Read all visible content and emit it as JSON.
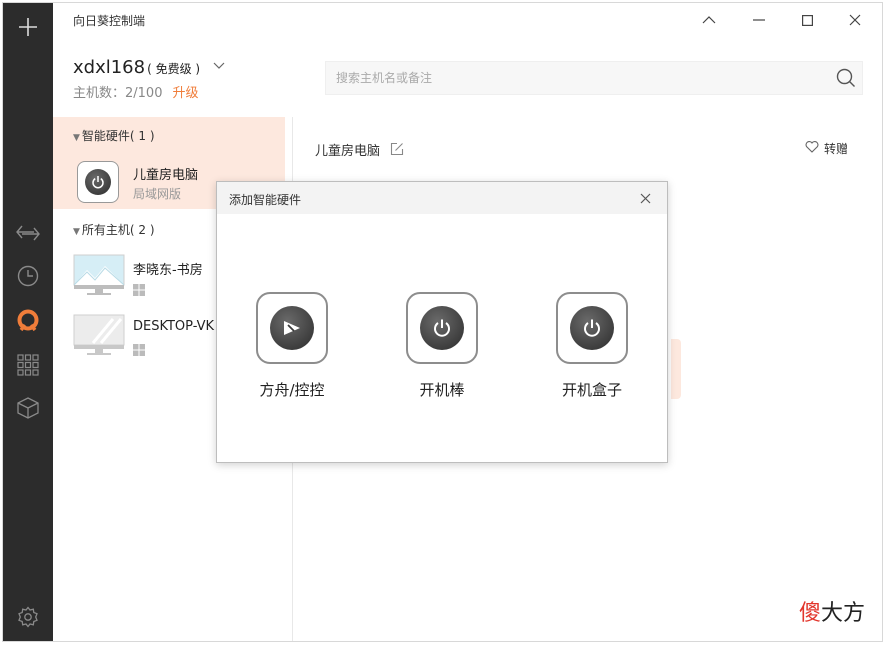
{
  "app": {
    "title": "向日葵控制端"
  },
  "account": {
    "username": "xdxl168",
    "plan": "( 免费级 )",
    "host_count": "主机数：2/100",
    "upgrade": "升级"
  },
  "search": {
    "placeholder": "搜索主机名或备注"
  },
  "groups": {
    "smart": {
      "label": "智能硬件( 1 )",
      "device": {
        "name": "儿童房电脑",
        "sub": "局域网版"
      }
    },
    "hosts": {
      "label": "所有主机( 2 )",
      "items": [
        {
          "name": "李晓东-书房"
        },
        {
          "name": "DESKTOP-VK"
        }
      ]
    }
  },
  "detail": {
    "name": "儿童房电脑",
    "transfer": "转赠"
  },
  "dialog": {
    "title": "添加智能硬件",
    "options": [
      {
        "label": "方舟/控控",
        "icon": "ark-icon"
      },
      {
        "label": "开机棒",
        "icon": "power-icon"
      },
      {
        "label": "开机盒子",
        "icon": "power-icon"
      }
    ]
  },
  "watermark": {
    "red": "傻",
    "dark": "大方"
  },
  "colors": {
    "rail": "#2c2c2c",
    "accent": "#f07d3a",
    "selected": "#fde8de"
  }
}
